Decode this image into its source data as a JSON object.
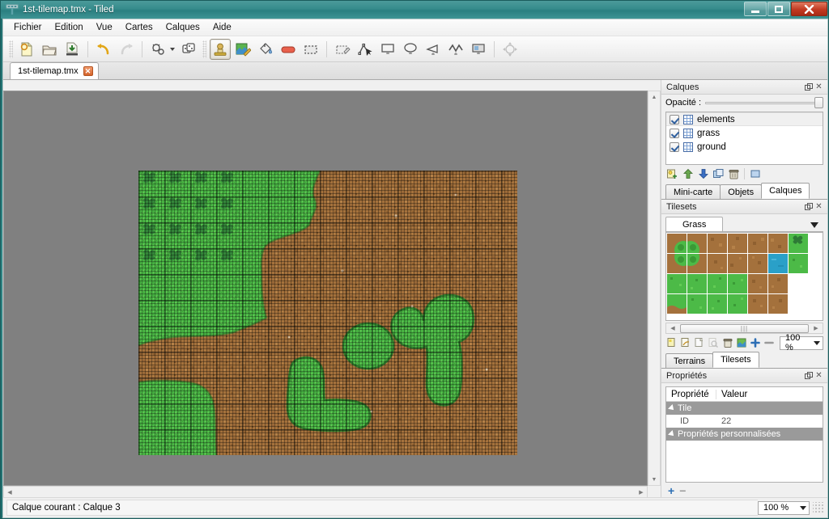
{
  "window": {
    "title": "1st-tilemap.tmx - Tiled",
    "app_icon": "tiled-logo-icon",
    "controls": {
      "minimize": "minimize-button",
      "maximize": "maximize-button",
      "close": "close-button"
    }
  },
  "menu": {
    "items": [
      {
        "label": "Fichier"
      },
      {
        "label": "Edition"
      },
      {
        "label": "Vue"
      },
      {
        "label": "Cartes"
      },
      {
        "label": "Calques"
      },
      {
        "label": "Aide"
      }
    ]
  },
  "toolbar": {
    "groups": [
      {
        "buttons": [
          {
            "name": "new-map-button",
            "icon": "new-document-icon",
            "state": "normal"
          },
          {
            "name": "open-map-button",
            "icon": "open-folder-icon",
            "state": "normal"
          },
          {
            "name": "save-map-button",
            "icon": "save-disk-icon",
            "state": "normal"
          }
        ]
      },
      {
        "buttons": [
          {
            "name": "undo-button",
            "icon": "undo-arrow-icon",
            "state": "normal"
          },
          {
            "name": "redo-button",
            "icon": "redo-arrow-icon",
            "state": "disabled"
          }
        ]
      },
      {
        "buttons": [
          {
            "name": "map-properties-button",
            "icon": "map-gears-icon",
            "state": "normal",
            "has_menu": true
          },
          {
            "name": "tile-properties-button",
            "icon": "dice-tiles-icon",
            "state": "normal"
          }
        ]
      },
      {
        "buttons": [
          {
            "name": "stamp-brush-tool",
            "icon": "stamp-icon",
            "state": "checked"
          },
          {
            "name": "terrain-brush-tool",
            "icon": "terrain-pencil-icon",
            "state": "normal"
          },
          {
            "name": "bucket-fill-tool",
            "icon": "paint-bucket-icon",
            "state": "normal"
          },
          {
            "name": "eraser-tool",
            "icon": "eraser-icon",
            "state": "normal"
          },
          {
            "name": "rectangular-select-tool",
            "icon": "marquee-select-icon",
            "state": "normal"
          }
        ]
      },
      {
        "buttons": [
          {
            "name": "magic-wand-tool",
            "icon": "magic-wand-icon",
            "state": "normal"
          },
          {
            "name": "select-object-tool",
            "icon": "object-select-icon",
            "state": "normal"
          },
          {
            "name": "insert-rectangle-tool",
            "icon": "insert-rectangle-icon",
            "state": "normal"
          },
          {
            "name": "insert-ellipse-tool",
            "icon": "insert-ellipse-icon",
            "state": "normal"
          },
          {
            "name": "insert-polygon-tool",
            "icon": "insert-polygon-icon",
            "state": "normal"
          },
          {
            "name": "insert-polyline-tool",
            "icon": "insert-polyline-icon",
            "state": "normal"
          },
          {
            "name": "insert-tile-object-tool",
            "icon": "insert-tile-icon",
            "state": "normal"
          }
        ]
      },
      {
        "buttons": [
          {
            "name": "edit-polygons-tool",
            "icon": "edit-polygons-icon",
            "state": "disabled"
          }
        ]
      }
    ]
  },
  "document_tabs": [
    {
      "label": "1st-tilemap.tmx",
      "active": true,
      "close_icon": "close-tab-icon"
    }
  ],
  "map_view": {
    "background_color": "#808080",
    "tile_size": 32,
    "grid_visible": true,
    "scrollbars": {
      "vertical": {
        "up_arrow": "scroll-up-icon",
        "down_arrow": "scroll-down-icon"
      },
      "horizontal": {
        "left_arrow": "scroll-left-icon",
        "right_arrow": "scroll-right-icon"
      }
    }
  },
  "layers_panel": {
    "title": "Calques",
    "float_icon": "undock-icon",
    "close_icon": "close-panel-icon",
    "opacity_label": "Opacité :",
    "opacity_value": 100,
    "layers": [
      {
        "name": "elements",
        "visible": true,
        "selected": true,
        "icon": "tile-layer-icon"
      },
      {
        "name": "grass",
        "visible": true,
        "selected": false,
        "icon": "tile-layer-icon"
      },
      {
        "name": "ground",
        "visible": true,
        "selected": false,
        "icon": "tile-layer-icon"
      }
    ],
    "toolbar": [
      {
        "name": "new-layer-button",
        "icon": "new-layer-icon"
      },
      {
        "name": "move-layer-up-button",
        "icon": "arrow-up-icon"
      },
      {
        "name": "move-layer-down-button",
        "icon": "arrow-down-icon"
      },
      {
        "name": "duplicate-layer-button",
        "icon": "duplicate-layer-icon"
      },
      {
        "name": "delete-layer-button",
        "icon": "trash-icon"
      },
      {
        "name": "layer-properties-button",
        "icon": "layer-properties-icon"
      }
    ],
    "tabs": [
      {
        "label": "Mini-carte",
        "active": false
      },
      {
        "label": "Objets",
        "active": false
      },
      {
        "label": "Calques",
        "active": true
      }
    ]
  },
  "tilesets_panel": {
    "title": "Tilesets",
    "float_icon": "undock-icon",
    "close_icon": "close-panel-icon",
    "tileset_tab": "Grass",
    "dropdown_icon": "chevron-down-icon",
    "tiles": [
      {
        "id": 0,
        "kind": "bush-dirt-topleft"
      },
      {
        "id": 1,
        "kind": "bush-dirt-topright"
      },
      {
        "id": 2,
        "kind": "dirt"
      },
      {
        "id": 3,
        "kind": "dirt"
      },
      {
        "id": 4,
        "kind": "dirt"
      },
      {
        "id": 5,
        "kind": "dirt"
      },
      {
        "id": 6,
        "kind": "grass-flower"
      },
      {
        "id": 7,
        "kind": "bush-dirt-bottomleft"
      },
      {
        "id": 8,
        "kind": "bush-dirt-bottomright"
      },
      {
        "id": 9,
        "kind": "dirt"
      },
      {
        "id": 10,
        "kind": "dirt"
      },
      {
        "id": 11,
        "kind": "dirt"
      },
      {
        "id": 12,
        "kind": "dirt"
      },
      {
        "id": 13,
        "kind": "water"
      },
      {
        "id": 14,
        "kind": "grass"
      },
      {
        "id": 15,
        "kind": "grass"
      },
      {
        "id": 16,
        "kind": "grass"
      },
      {
        "id": 17,
        "kind": "grass"
      },
      {
        "id": 18,
        "kind": "dirt"
      },
      {
        "id": 19,
        "kind": "dirt"
      },
      {
        "id": 20,
        "kind": "grass-dirt-bottom"
      },
      {
        "id": 21,
        "kind": "grass"
      },
      {
        "id": 22,
        "kind": "grass"
      },
      {
        "id": 23,
        "kind": "grass"
      },
      {
        "id": 24,
        "kind": "dirt"
      },
      {
        "id": 25,
        "kind": "dirt"
      }
    ],
    "scroll_thumb_glyph": "|||",
    "toolbar": [
      {
        "name": "new-tileset-button",
        "icon": "new-tileset-icon",
        "state": "normal"
      },
      {
        "name": "import-tileset-button",
        "icon": "import-tileset-icon",
        "state": "normal"
      },
      {
        "name": "export-tileset-button",
        "icon": "export-tileset-icon",
        "state": "normal"
      },
      {
        "name": "tileset-properties-button",
        "icon": "tileset-properties-icon",
        "state": "disabled"
      },
      {
        "name": "remove-tileset-button",
        "icon": "trash-icon",
        "state": "normal"
      },
      {
        "name": "edit-terrain-button",
        "icon": "edit-terrain-icon",
        "state": "normal"
      },
      {
        "name": "zoom-in-button",
        "icon": "plus-icon",
        "state": "normal"
      },
      {
        "name": "zoom-out-button",
        "icon": "minus-icon",
        "state": "normal"
      }
    ],
    "zoom_value": "100 %",
    "tabs": [
      {
        "label": "Terrains",
        "active": false
      },
      {
        "label": "Tilesets",
        "active": true
      }
    ]
  },
  "properties_panel": {
    "title": "Propriétés",
    "float_icon": "undock-icon",
    "close_icon": "close-panel-icon",
    "columns": [
      "Propriété",
      "Valeur"
    ],
    "rows": [
      {
        "type": "group",
        "label": "Tile"
      },
      {
        "type": "item",
        "label": "ID",
        "value": "22"
      },
      {
        "type": "group",
        "label": "Propriétés personnalisées"
      }
    ],
    "footer": [
      {
        "name": "add-property-button",
        "icon": "plus-icon",
        "state": "normal"
      },
      {
        "name": "remove-property-button",
        "icon": "minus-icon",
        "state": "disabled"
      }
    ]
  },
  "statusbar": {
    "message": "Calque courant : Calque 3",
    "zoom_value": "100 %",
    "resize_grip": "resize-grip-icon"
  },
  "colors": {
    "titlebar": "#368c8c",
    "canvas_bg": "#808080",
    "grass": "#4fbb4a",
    "dirt": "#9a6a3a",
    "water": "#2aa0c8",
    "group_row": "#9a9a9a",
    "close_button": "#c23a22"
  }
}
